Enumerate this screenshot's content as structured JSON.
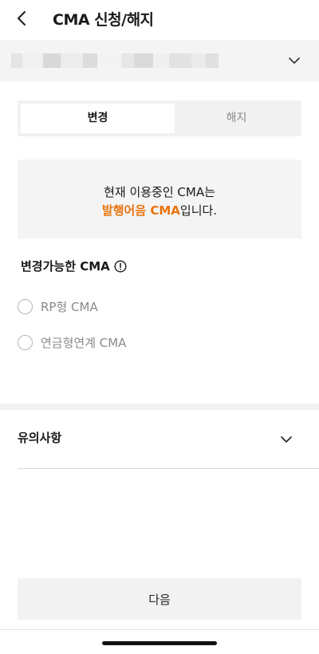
{
  "header": {
    "title": "CMA 신청/해지"
  },
  "account": {
    "masked_colors": [
      "#e4e4e4",
      "#f0f0f0",
      "#d8d8d8",
      "#ececec",
      "#dcdcdc",
      "#f3f3f3",
      "#e6e6e6",
      "#dadada",
      "#efefef",
      "#e2e2e2",
      "#ebebeb",
      "#e0e0e0"
    ]
  },
  "tabs": [
    {
      "label": "변경",
      "active": true
    },
    {
      "label": "해지",
      "active": false
    }
  ],
  "info": {
    "line1": "현재 이용중인 CMA는",
    "product": "발행어음 CMA",
    "suffix": "입니다.",
    "highlight_color": "#e8730c"
  },
  "section": {
    "title": "변경가능한 CMA"
  },
  "options": [
    {
      "label": "RP형 CMA",
      "selected": false
    },
    {
      "label": "연금형연계 CMA",
      "selected": false
    }
  ],
  "notice": {
    "label": "유의사항"
  },
  "footer": {
    "next_label": "다음"
  }
}
